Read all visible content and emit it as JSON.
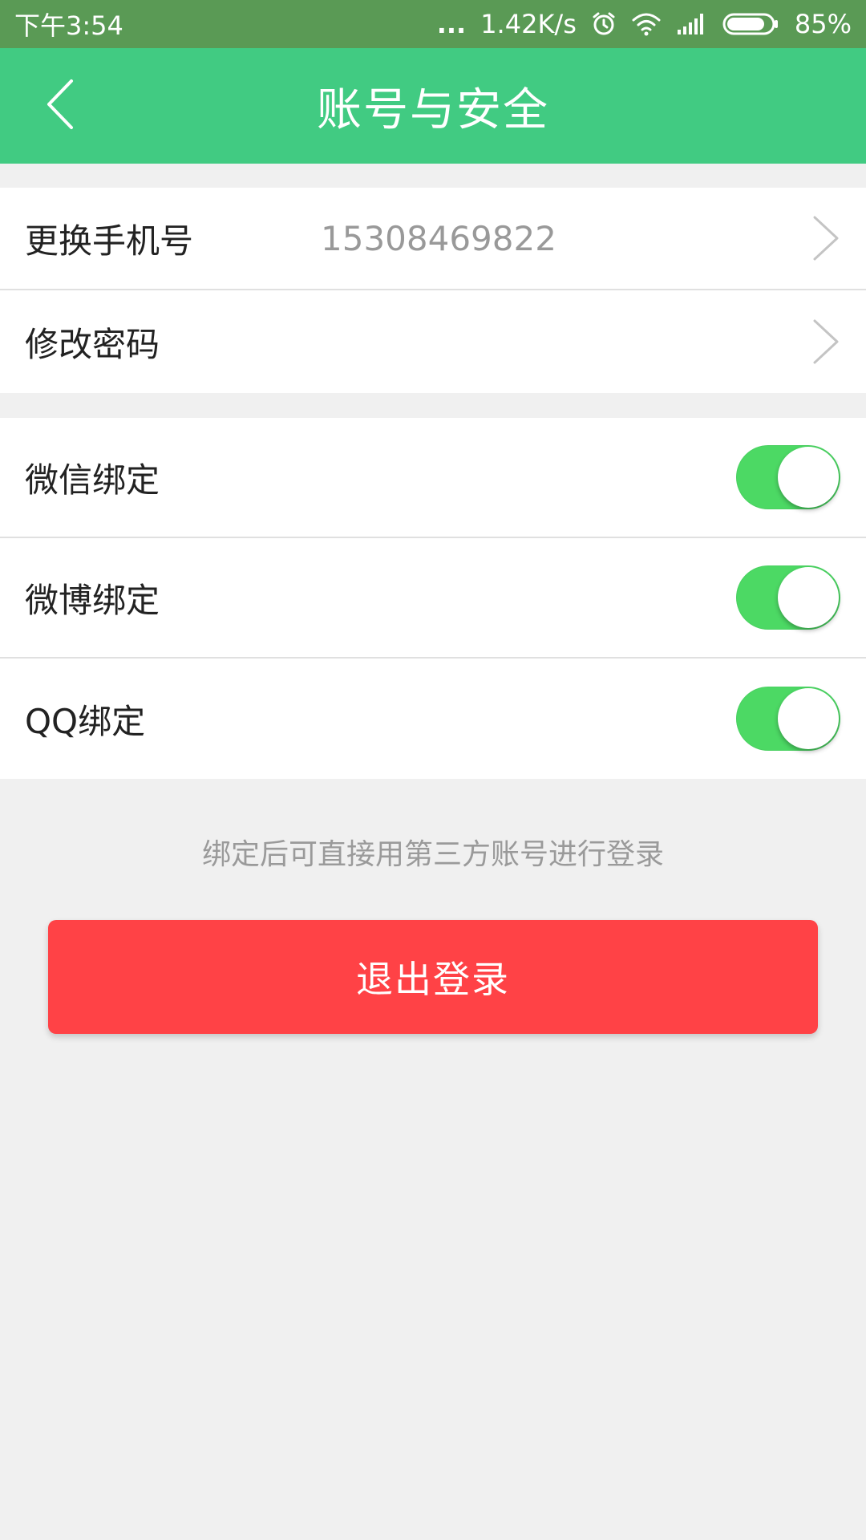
{
  "status_bar": {
    "time": "下午3:54",
    "dots": "...",
    "net_speed": "1.42K/s",
    "battery_percent": "85%",
    "battery_level": 0.85,
    "icons": [
      "alarm-icon",
      "wifi-icon",
      "signal-icon",
      "battery-icon"
    ]
  },
  "nav": {
    "title": "账号与安全",
    "back_icon": "chevron-left-icon"
  },
  "account_group": [
    {
      "label": "更换手机号",
      "value": "15308469822",
      "icon": "chevron-right-icon"
    },
    {
      "label": "修改密码",
      "value": "",
      "icon": "chevron-right-icon"
    }
  ],
  "binding_group": [
    {
      "label": "微信绑定",
      "enabled": true
    },
    {
      "label": "微博绑定",
      "enabled": true
    },
    {
      "label": "QQ绑定",
      "enabled": true
    }
  ],
  "hint": "绑定后可直接用第三方账号进行登录",
  "logout_label": "退出登录",
  "colors": {
    "status_bar": "#5a9a55",
    "nav_bar": "#41cb82",
    "switch_on": "#4cd964",
    "logout": "#ff4246",
    "background": "#f0f0f0"
  }
}
